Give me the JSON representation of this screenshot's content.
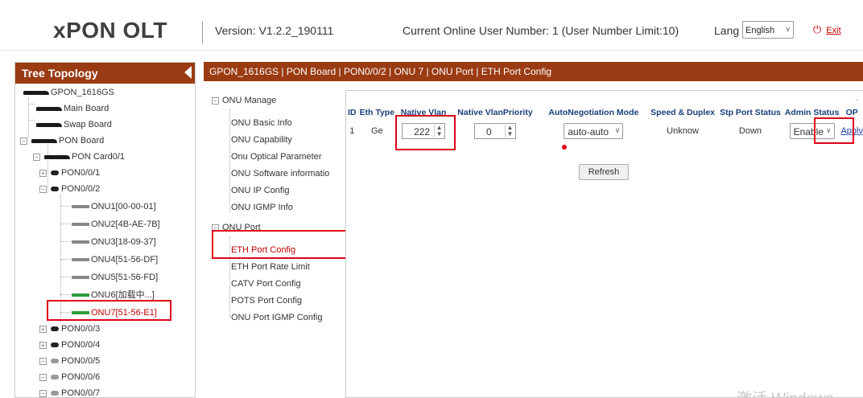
{
  "header": {
    "logo": "xPON OLT",
    "version": "Version: V1.2.2_190111",
    "online_users": "Current Online User Number: 1 (User Number Limit:10)",
    "lang_label": "Lang",
    "lang_value": "English",
    "exit_label": "Exit"
  },
  "tree": {
    "title": "Tree Topology",
    "nodes": [
      {
        "label": "GPON_1616GS"
      },
      {
        "label": "Main Board"
      },
      {
        "label": "Swap Board"
      },
      {
        "label": "PON Board"
      },
      {
        "label": "PON Card0/1"
      },
      {
        "label": "PON0/0/1"
      },
      {
        "label": "PON0/0/2"
      },
      {
        "label": "ONU1[00-00-01]"
      },
      {
        "label": "ONU2[4B-AE-7B]"
      },
      {
        "label": "ONU3[18-09-37]"
      },
      {
        "label": "ONU4[51-56-DF]"
      },
      {
        "label": "ONU5[51-56-FD]"
      },
      {
        "label": "ONU6[加载中...]"
      },
      {
        "label": "ONU7[51-56-E1]"
      },
      {
        "label": "PON0/0/3"
      },
      {
        "label": "PON0/0/4"
      },
      {
        "label": "PON0/0/5"
      },
      {
        "label": "PON0/0/6"
      },
      {
        "label": "PON0/0/7"
      }
    ]
  },
  "breadcrumb": "GPON_1616GS | PON Board | PON0/0/2 | ONU 7 | ONU Port | ETH Port Config",
  "menu": {
    "groups": [
      {
        "label": "ONU Manage",
        "items": [
          "ONU Basic Info",
          "ONU Capability",
          "Onu Optical Parameter",
          "ONU Software informatio",
          "ONU IP Config",
          "ONU IGMP Info"
        ]
      },
      {
        "label": "ONU Port",
        "items": [
          "ETH Port Config",
          "ETH Port Rate Limit",
          "CATV Port Config",
          "POTS Port Config",
          "ONU Port IGMP Config"
        ]
      }
    ],
    "active_item": "ETH Port Config"
  },
  "eth_table": {
    "headers": [
      "ID",
      "Eth Type",
      "Native Vlan",
      "Native VlanPriority",
      "AutoNegotiation Mode",
      "Speed & Duplex",
      "Stp Port Status",
      "Admin Status",
      "OP"
    ],
    "rows": [
      {
        "id": "1",
        "eth_type": "Ge",
        "native_vlan": "222",
        "native_vlan_priority": "0",
        "autoneg_mode": "auto-auto",
        "speed_duplex": "Unknow",
        "stp_status": "Down",
        "admin_status": "Enable",
        "op": "Apply"
      }
    ],
    "refresh_label": "Refresh"
  },
  "watermark": "激活 Windows",
  "colors": {
    "brand": "#9a3b13",
    "highlight": "#e0001b",
    "header_text": "#1a3f7a",
    "active": "#c00000"
  }
}
